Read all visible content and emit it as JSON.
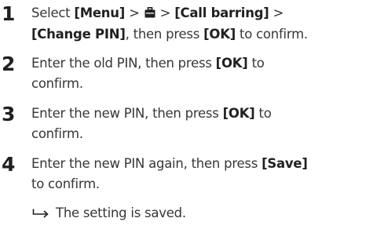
{
  "steps": [
    {
      "number": "1",
      "line1": {
        "t1": "Select ",
        "k1": "[Menu]",
        "t2": " > ",
        "icon": "briefcase-icon",
        "t3": " > ",
        "k2": "[Call barring]",
        "t4": " >"
      },
      "line2": {
        "k1": "[Change PIN]",
        "t1": ", then press ",
        "k2": "[OK]",
        "t2": " to confirm."
      }
    },
    {
      "number": "2",
      "line1": {
        "t1": "Enter the old PIN, then press ",
        "k1": "[OK]",
        "t2": " to"
      },
      "line2": {
        "t1": "confirm."
      }
    },
    {
      "number": "3",
      "line1": {
        "t1": "Enter the new PIN, then press ",
        "k1": "[OK]",
        "t2": " to"
      },
      "line2": {
        "t1": "confirm."
      }
    },
    {
      "number": "4",
      "line1": {
        "t1": "Enter the new PIN again, then press ",
        "k1": "[Save]"
      },
      "line2": {
        "t1": "to confirm."
      }
    }
  ],
  "result": {
    "icon": "result-arrow-icon",
    "text": "The setting is saved."
  }
}
